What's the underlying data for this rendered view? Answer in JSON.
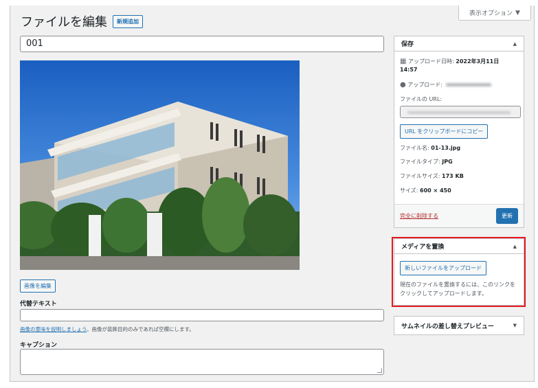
{
  "screen_options": {
    "label": "表示オプション",
    "icon": "caret-down-icon"
  },
  "header": {
    "title": "ファイルを編集",
    "add_new": "新規追加"
  },
  "title_field": {
    "value": "001"
  },
  "image": {
    "alt": "",
    "edit_button": "画像を編集"
  },
  "alt_text": {
    "label": "代替テキスト",
    "value": "",
    "help_link": "画像の意味を説明しましょう",
    "help_rest": "。画像が装飾目的のみであれば空欄にします。"
  },
  "caption": {
    "label": "キャプション",
    "value": ""
  },
  "save_box": {
    "title": "保存",
    "toggle": "▲",
    "uploaded_on_label": "アップロード日時:",
    "uploaded_on_value": "2022年3月11日 14:57",
    "uploaded_by_label": "アップロード:",
    "file_url_label": "ファイルの URL:",
    "copy_button": "URL をクリップボードにコピー",
    "file_name_label": "ファイル名:",
    "file_name_value": "01-13.jpg",
    "file_type_label": "ファイルタイプ:",
    "file_type_value": "JPG",
    "file_size_label": "ファイルサイズ:",
    "file_size_value": "173 KB",
    "dimensions_label": "サイズ:",
    "dimensions_value": "600 × 450",
    "delete_link": "完全に削除する",
    "update_button": "更新"
  },
  "replace_box": {
    "title": "メディアを置換",
    "toggle": "▲",
    "upload_button": "新しいファイルをアップロード",
    "description": "現在のファイルを置換するには、このリンクをクリックしてアップロードします。"
  },
  "thumb_box": {
    "title": "サムネイルの差し替えプレビュー",
    "toggle": "▼"
  },
  "colors": {
    "accent": "#2271b1",
    "highlight": "#e1191d",
    "delete": "#b32d2e"
  }
}
